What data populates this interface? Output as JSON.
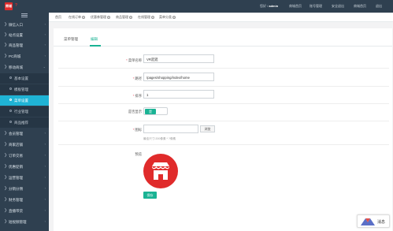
{
  "brand": {
    "logo_text": "商城",
    "name": "?"
  },
  "top_nav": {
    "greeting": "您好 /",
    "user": "admin",
    "links": [
      "商城首页",
      "账号管理",
      "安全退出",
      "商城首页",
      "退出"
    ]
  },
  "sidebar": {
    "items": [
      {
        "label": "微信入口"
      },
      {
        "label": "站点设置"
      },
      {
        "label": "商品管理"
      },
      {
        "label": "PC商城"
      },
      {
        "label": "移动商城"
      },
      {
        "label": "基本设置",
        "sub": true
      },
      {
        "label": "模板管理",
        "sub": true
      },
      {
        "label": "菜单设置",
        "sub": true,
        "active": true
      },
      {
        "label": "行业管理",
        "sub": true
      },
      {
        "label": "商品推荐",
        "sub": true
      },
      {
        "label": "会员管理"
      },
      {
        "label": "商家店铺"
      },
      {
        "label": "订单交易"
      },
      {
        "label": "优惠促销"
      },
      {
        "label": "运营管理"
      },
      {
        "label": "分销分佣"
      },
      {
        "label": "财务管理"
      },
      {
        "label": "直播带货"
      },
      {
        "label": "短视频管理"
      }
    ]
  },
  "tabs": [
    "首页",
    "在线订单",
    "优惠券管理",
    "商品管理",
    "在线管理",
    "菜单分类"
  ],
  "panel": {
    "tabs": [
      {
        "label": "菜单管理"
      },
      {
        "label": "编辑",
        "active": true
      }
    ],
    "fields": {
      "name": {
        "label": "菜单名称",
        "value": "VR逛逛"
      },
      "path": {
        "label": "路径",
        "value": "/pages/shopping/index/home"
      },
      "sort": {
        "label": "排序",
        "value": "1"
      },
      "display": {
        "label": "是否显示",
        "value": "是"
      },
      "icon": {
        "label": "图标",
        "browse": "浏览",
        "hint": "最佳尺寸:200像素 * ?像素"
      },
      "preview": {
        "label": "预览",
        "colors": {
          "circle": "#e02b2b",
          "icon": "#ffffff"
        }
      }
    },
    "submit": "保存"
  },
  "chat": {
    "label": "消息"
  },
  "colors": {
    "accent": "#1ab394",
    "sidebar": "#2f4050",
    "active_menu": "#1fb3d5",
    "brand_red": "#e02b2b"
  }
}
